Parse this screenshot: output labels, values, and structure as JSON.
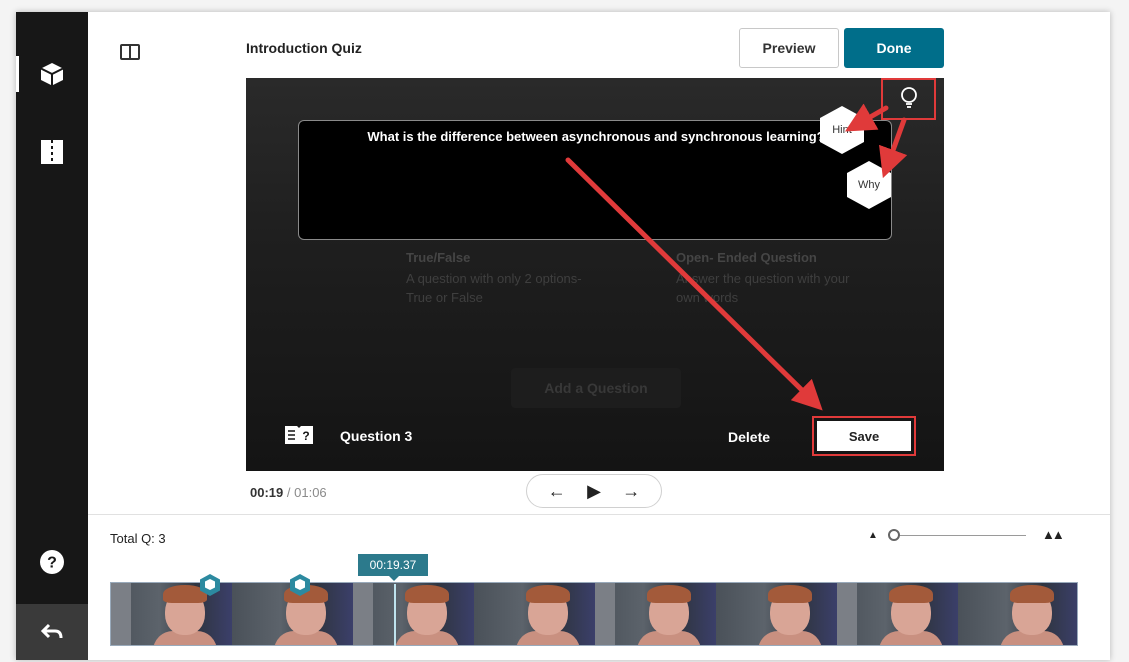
{
  "quiz": {
    "title": "Introduction Quiz",
    "preview_label": "Preview",
    "done_label": "Done"
  },
  "colors": {
    "accent": "#006e8a",
    "annotation": "#e03a3a",
    "sidebar": "#171717",
    "timeline_tag": "#2c7a8c"
  },
  "sidebar": {
    "items": [
      {
        "icon": "cube-icon",
        "active": true
      },
      {
        "icon": "chapters-icon",
        "active": false
      }
    ],
    "help_icon": "help-icon",
    "back_icon": "back-arrow-icon"
  },
  "question": {
    "text": "What is the difference between asynchronous and synchronous learning?",
    "hint_label": "Hint",
    "why_label": "Why",
    "footer_label": "Question 3",
    "delete_label": "Delete",
    "save_label": "Save"
  },
  "background_menu": {
    "true_false": {
      "title": "True/False",
      "desc": "A question with only 2 options- True or False"
    },
    "open_ended": {
      "title": "Open- Ended Question",
      "desc": "Answer the question with your own words"
    },
    "add_label": "Add a Question"
  },
  "player": {
    "current_time": "00:19",
    "separator": "/",
    "duration": "01:06",
    "prev_icon": "arrow-left-icon",
    "play_icon": "play-icon",
    "next_icon": "arrow-right-icon"
  },
  "timeline": {
    "total_label": "Total Q: 3",
    "playhead_time": "00:19.37"
  }
}
